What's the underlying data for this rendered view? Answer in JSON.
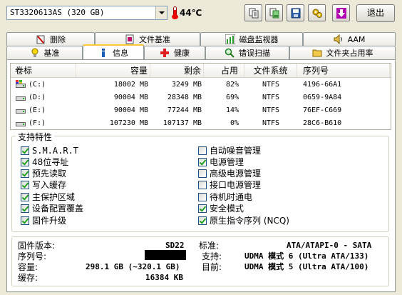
{
  "toolbar": {
    "drive": "ST3320613AS (320 GB)",
    "temperature": "44℃",
    "exit_label": "退出"
  },
  "tabs": {
    "row1": [
      "删除",
      "文件基准",
      "磁盘监视器",
      "AAM"
    ],
    "row2": [
      "基准",
      "信息",
      "健康",
      "错误扫描",
      "文件夹占用率"
    ],
    "active": "信息"
  },
  "volumes": {
    "headers": [
      "卷标",
      "容量",
      "剩余",
      "占用",
      "文件系统",
      "序列号"
    ],
    "rows": [
      {
        "label": "(C:)",
        "capacity": "18002 MB",
        "free": "3249 MB",
        "used": "82%",
        "fs": "NTFS",
        "serial": "4196-66A1"
      },
      {
        "label": "(D:)",
        "capacity": "90004 MB",
        "free": "28348 MB",
        "used": "69%",
        "fs": "NTFS",
        "serial": "0659-9A84"
      },
      {
        "label": "(E:)",
        "capacity": "90004 MB",
        "free": "77244 MB",
        "used": "14%",
        "fs": "NTFS",
        "serial": "76EF-C669"
      },
      {
        "label": "(F:)",
        "capacity": "107230 MB",
        "free": "107137 MB",
        "used": "0%",
        "fs": "NTFS",
        "serial": "28C6-B610"
      }
    ]
  },
  "features": {
    "title": "支持特性",
    "left": [
      {
        "label": "S.M.A.R.T",
        "checked": true
      },
      {
        "label": "48位寻址",
        "checked": true
      },
      {
        "label": "预先读取",
        "checked": true
      },
      {
        "label": "写入缓存",
        "checked": true
      },
      {
        "label": "主保护区域",
        "checked": true
      },
      {
        "label": "设备配置覆盖",
        "checked": true
      },
      {
        "label": "固件升级",
        "checked": true
      }
    ],
    "right": [
      {
        "label": "自动噪音管理",
        "checked": false
      },
      {
        "label": "电源管理",
        "checked": true
      },
      {
        "label": "高级电源管理",
        "checked": false
      },
      {
        "label": "接口电源管理",
        "checked": false
      },
      {
        "label": "待机时通电",
        "checked": false
      },
      {
        "label": "安全模式",
        "checked": true
      },
      {
        "label": "原生指令序列 (NCQ)",
        "checked": true
      }
    ]
  },
  "info": {
    "firmware_label": "固件版本:",
    "firmware_value": "SD22",
    "serial_label": "序列号:",
    "capacity_label": "容量:",
    "capacity_value": "298.1 GB (~320.1 GB)",
    "cache_label": "缓存:",
    "cache_value": "16384 KB",
    "standard_label": "标准:",
    "standard_value": "ATA/ATAPI-0 - SATA",
    "supported_label": "支持:",
    "supported_value": "UDMA 模式 6 (Ultra ATA/133)",
    "current_label": "目前:",
    "current_value": "UDMA 模式 5 (Ultra ATA/100)"
  }
}
